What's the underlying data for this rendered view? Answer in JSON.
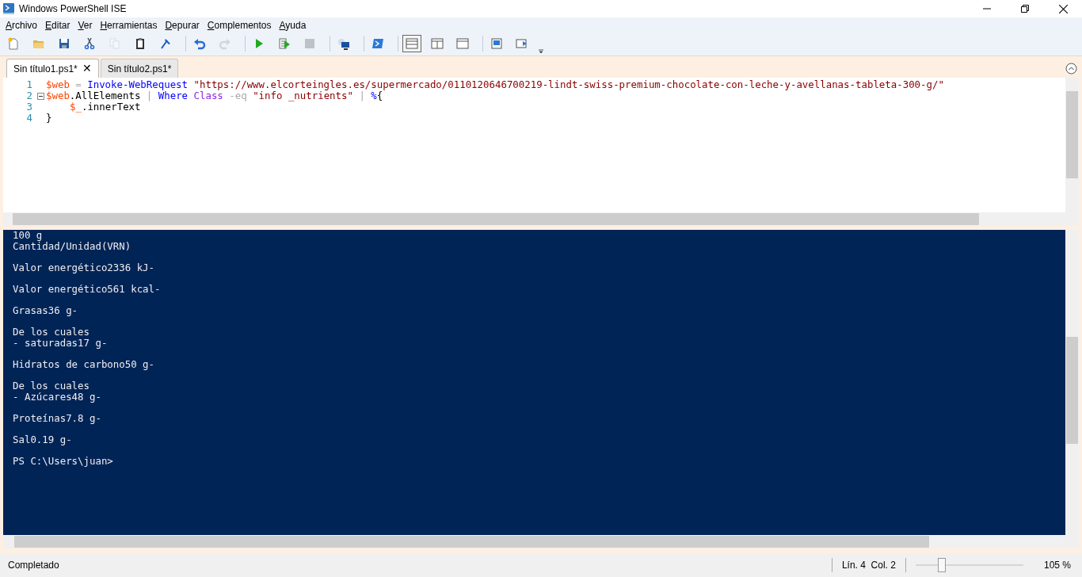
{
  "window": {
    "title": "Windows PowerShell ISE"
  },
  "menu": [
    "Archivo",
    "Editar",
    "Ver",
    "Herramientas",
    "Depurar",
    "Complementos",
    "Ayuda"
  ],
  "toolbar": [
    {
      "kind": "new",
      "disabled": false
    },
    {
      "kind": "open",
      "disabled": false
    },
    {
      "kind": "save",
      "disabled": false
    },
    {
      "kind": "cut",
      "disabled": false
    },
    {
      "kind": "copy",
      "disabled": true
    },
    {
      "kind": "paste",
      "disabled": false
    },
    {
      "kind": "clear",
      "disabled": false
    },
    {
      "kind": "separator"
    },
    {
      "kind": "undo",
      "disabled": false
    },
    {
      "kind": "redo",
      "disabled": true
    },
    {
      "kind": "separator"
    },
    {
      "kind": "run",
      "disabled": false
    },
    {
      "kind": "run-selection",
      "disabled": false
    },
    {
      "kind": "stop",
      "disabled": true
    },
    {
      "kind": "separator"
    },
    {
      "kind": "remote",
      "disabled": false
    },
    {
      "kind": "separator"
    },
    {
      "kind": "powershell",
      "disabled": false
    },
    {
      "kind": "separator"
    },
    {
      "kind": "layout-top",
      "selected": true
    },
    {
      "kind": "layout-right",
      "selected": false
    },
    {
      "kind": "layout-max",
      "selected": false
    },
    {
      "kind": "separator"
    },
    {
      "kind": "show-script",
      "disabled": false
    },
    {
      "kind": "show-console",
      "disabled": false
    }
  ],
  "tabs": [
    {
      "label": "Sin título1.ps1*",
      "selected": true,
      "close": "✕"
    },
    {
      "label": "Sin título2.ps1*",
      "selected": false
    }
  ],
  "editor": {
    "lines": [
      {
        "number": "1",
        "collapsible": false,
        "indented": false,
        "tokens": [
          {
            "kind": "variable",
            "text": "$web"
          },
          {
            "kind": "operator",
            "text": " ="
          },
          {
            "kind": "command",
            "text": " Invoke-WebRequest"
          },
          {
            "kind": "string",
            "text": " \"https://www.elcorteingles.es/supermercado/0110120646700219-lindt-swiss-premium-chocolate-con-leche-y-avellanas-tableta-300-g/\""
          }
        ]
      },
      {
        "number": "2",
        "collapsible": true,
        "indented": false,
        "tokens": [
          {
            "kind": "variable",
            "text": "$web"
          },
          {
            "kind": "plain",
            "text": ".AllElements"
          },
          {
            "kind": "operator",
            "text": " |"
          },
          {
            "kind": "command",
            "text": " Where"
          },
          {
            "kind": "parameter",
            "text": " Class"
          },
          {
            "kind": "operator",
            "text": " -eq"
          },
          {
            "kind": "string",
            "text": " \"info _nutrients\""
          },
          {
            "kind": "operator",
            "text": " |"
          },
          {
            "kind": "command",
            "text": " %"
          },
          {
            "kind": "plain",
            "text": "{"
          }
        ]
      },
      {
        "number": "3",
        "collapsible": false,
        "indented": true,
        "tokens": [
          {
            "kind": "variable",
            "text": "$_"
          },
          {
            "kind": "plain",
            "text": ".innerText"
          }
        ]
      },
      {
        "number": "4",
        "collapsible": false,
        "indented": false,
        "tokens": [
          {
            "kind": "plain",
            "text": "}"
          }
        ]
      }
    ]
  },
  "console": {
    "paragraphs": [
      [
        "100 g",
        "Cantidad/Unidad(VRN)"
      ],
      [
        "Valor energético2336 kJ-"
      ],
      [
        "Valor energético561 kcal-"
      ],
      [
        "Grasas36 g-"
      ],
      [
        "De los cuales",
        "- saturadas17 g-"
      ],
      [
        "Hidratos de carbono50 g-"
      ],
      [
        "De los cuales",
        "- Azúcares48 g-"
      ],
      [
        "Proteínas7.8 g-"
      ],
      [
        "Sal0.19 g-"
      ],
      [
        "PS C:\\Users\\juan>"
      ]
    ]
  },
  "status_bar": {
    "status": "Completado",
    "position": "Lín. 4  Col. 2",
    "zoom": {
      "level": 0.22,
      "reading": "105 %"
    }
  }
}
